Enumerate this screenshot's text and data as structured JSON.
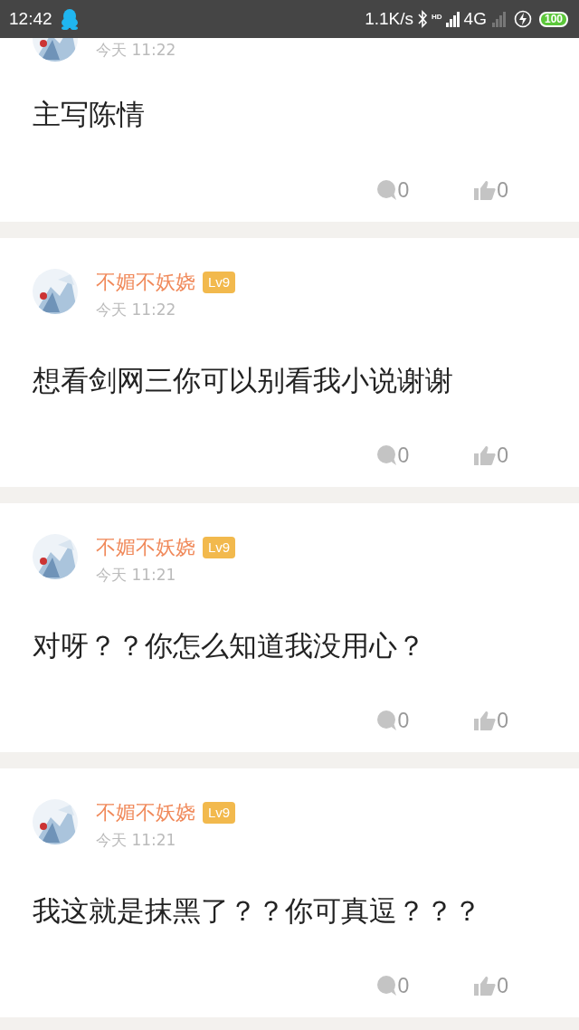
{
  "status_bar": {
    "time": "12:42",
    "speed": "1.1K/s",
    "hd": "HD",
    "network": "4G",
    "battery": "100"
  },
  "comments": [
    {
      "time": "今天 11:22",
      "text": "主写陈情",
      "replies": "0",
      "likes": "0",
      "cut": true
    },
    {
      "author": "不媚不妖娆",
      "level_badge": "Lv9",
      "time": "今天 11:22",
      "text": "想看剑网三你可以别看我小说谢谢",
      "replies": "0",
      "likes": "0",
      "cut": false
    },
    {
      "author": "不媚不妖娆",
      "level_badge": "Lv9",
      "time": "今天 11:21",
      "text": "对呀？？你怎么知道我没用心？",
      "replies": "0",
      "likes": "0",
      "cut": false
    },
    {
      "author": "不媚不妖娆",
      "level_badge": "Lv9",
      "time": "今天 11:21",
      "text": "我这就是抹黑了？？你可真逗？？？",
      "replies": "0",
      "likes": "0",
      "cut": false
    }
  ]
}
